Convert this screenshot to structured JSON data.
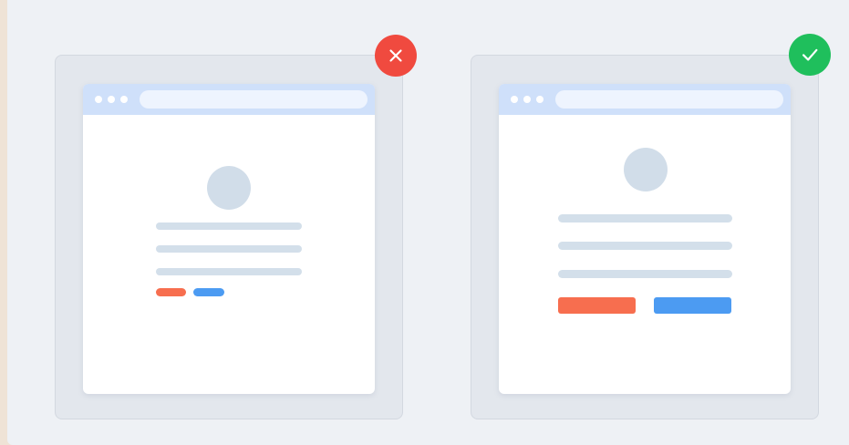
{
  "comparison": [
    {
      "verdict": "incorrect",
      "badge_icon": "x-icon",
      "badge_color": "#f04a3f"
    },
    {
      "verdict": "correct",
      "badge_icon": "check-icon",
      "badge_color": "#1fbf5c"
    }
  ],
  "colors": {
    "page_background": "#eef1f5",
    "panel_background": "#e3e7ed",
    "window_titlebar": "#cfe0fa",
    "placeholder": "#d3dfea",
    "primary_button": "#f76e4f",
    "secondary_button": "#4c9bf2"
  }
}
